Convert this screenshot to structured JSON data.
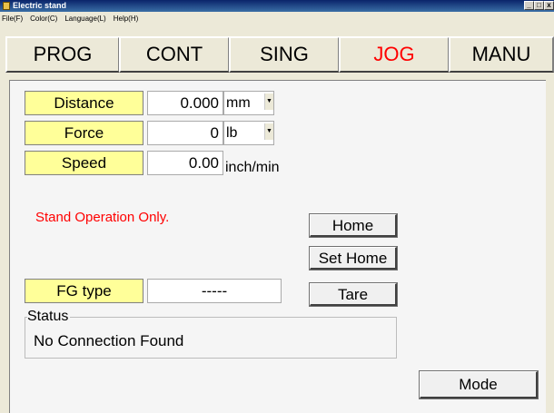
{
  "window": {
    "title": "Electric stand",
    "controls": [
      "_",
      "□",
      "x"
    ]
  },
  "menu": [
    "File(F)",
    "Color(C)",
    "Language(L)",
    "Help(H)"
  ],
  "tabs": [
    {
      "label": "PROG"
    },
    {
      "label": "CONT"
    },
    {
      "label": "SING"
    },
    {
      "label": "JOG",
      "active": true
    },
    {
      "label": "MANU"
    }
  ],
  "fields": {
    "distance": {
      "label": "Distance",
      "value": "0.000",
      "unit": "mm"
    },
    "force": {
      "label": "Force",
      "value": "0",
      "unit": "lb"
    },
    "speed": {
      "label": "Speed",
      "value": "0.00",
      "unit": "inch/min"
    }
  },
  "message": "Stand Operation Only.",
  "buttons": {
    "home": "Home",
    "set_home": "Set Home",
    "tare": "Tare",
    "mode": "Mode"
  },
  "fg_type": {
    "label": "FG type",
    "value": "-----"
  },
  "status": {
    "legend": "Status",
    "text": "No Connection Found"
  },
  "colors": {
    "label_bg": "#ffff99",
    "active_tab": "#ff0000",
    "message": "#ff0000"
  }
}
